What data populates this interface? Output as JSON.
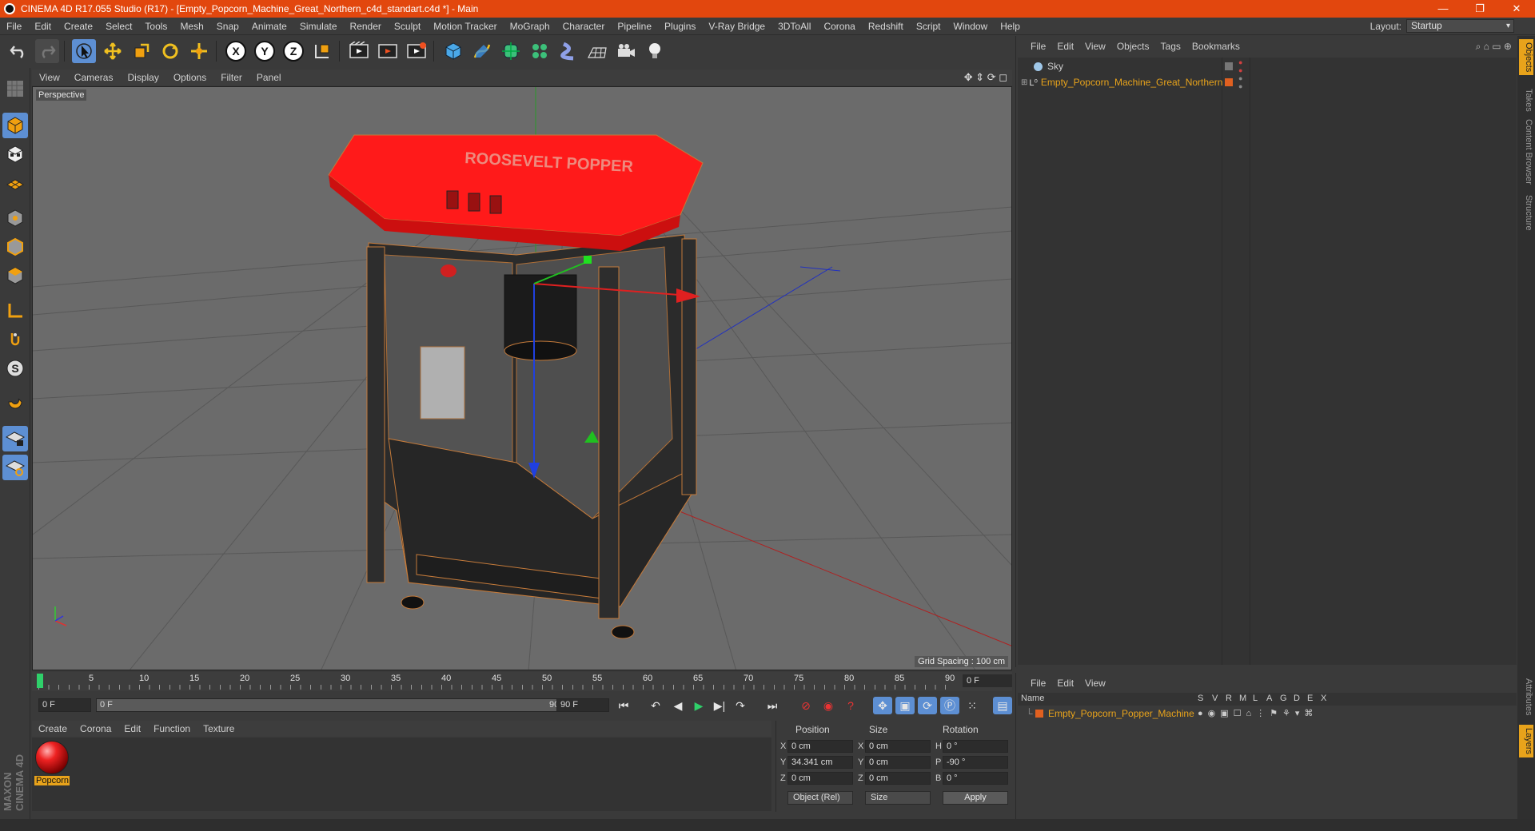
{
  "title_bar": {
    "title": "CINEMA 4D R17.055 Studio (R17) - [Empty_Popcorn_Machine_Great_Northern_c4d_standart.c4d *] - Main",
    "minimize": "—",
    "maximize": "❐",
    "close": "✕"
  },
  "menu": [
    "File",
    "Edit",
    "Create",
    "Select",
    "Tools",
    "Mesh",
    "Snap",
    "Animate",
    "Simulate",
    "Render",
    "Sculpt",
    "Motion Tracker",
    "MoGraph",
    "Character",
    "Pipeline",
    "Plugins",
    "V-Ray Bridge",
    "3DToAll",
    "Corona",
    "Redshift",
    "Script",
    "Window",
    "Help"
  ],
  "layout": {
    "label": "Layout:",
    "value": "Startup"
  },
  "toolbar": {
    "axis_x": "X",
    "axis_y": "Y",
    "axis_z": "Z"
  },
  "viewport": {
    "menu": [
      "View",
      "Cameras",
      "Display",
      "Options",
      "Filter",
      "Panel"
    ],
    "camera_label": "Perspective",
    "grid_spacing": "Grid Spacing : 100 cm",
    "sign_text": "ROOSEVELT POPPER"
  },
  "timeline": {
    "ticks": [
      "0",
      "5",
      "10",
      "15",
      "20",
      "25",
      "30",
      "35",
      "40",
      "45",
      "50",
      "55",
      "60",
      "65",
      "70",
      "75",
      "80",
      "85",
      "90"
    ],
    "current_frame": "0 F"
  },
  "playbar": {
    "start_frame": "0 F",
    "range_start": "0 F",
    "range_end": "90 F",
    "end_frame": "90 F"
  },
  "material_manager": {
    "menu": [
      "Create",
      "Corona",
      "Edit",
      "Function",
      "Texture"
    ],
    "materials": [
      {
        "name": "Popcorn",
        "color": "#e22222"
      }
    ]
  },
  "coordinates": {
    "headers": {
      "position": "Position",
      "size": "Size",
      "rotation": "Rotation"
    },
    "rows": [
      {
        "axis": "X",
        "pos": "0 cm",
        "size_axis": "X",
        "size": "0 cm",
        "rot_axis": "H",
        "rot": "0 °"
      },
      {
        "axis": "Y",
        "pos": "34.341 cm",
        "size_axis": "Y",
        "size": "0 cm",
        "rot_axis": "P",
        "rot": "-90 °"
      },
      {
        "axis": "Z",
        "pos": "0 cm",
        "size_axis": "Z",
        "size": "0 cm",
        "rot_axis": "B",
        "rot": "0 °"
      }
    ],
    "mode": "Object (Rel)",
    "size_mode": "Size",
    "apply": "Apply"
  },
  "object_manager": {
    "menu": [
      "File",
      "Edit",
      "View",
      "Objects",
      "Tags",
      "Bookmarks"
    ],
    "objects": [
      {
        "name": "Sky",
        "color": "#cfcfcf"
      },
      {
        "name": "Empty_Popcorn_Machine_Great_Northern",
        "color": "#e8a31b"
      }
    ]
  },
  "layer_manager": {
    "menu": [
      "File",
      "Edit",
      "View"
    ],
    "headers": [
      "Name",
      "S",
      "V",
      "R",
      "M",
      "L",
      "A",
      "G",
      "D",
      "E",
      "X"
    ],
    "layers": [
      {
        "name": "Empty_Popcorn_Popper_Machine",
        "color": "#e8a31b"
      }
    ]
  },
  "side_tabs": [
    "Objects",
    "Takes",
    "Content Browser",
    "Structure"
  ],
  "side_tabs_bottom": [
    "Attributes",
    "Layers"
  ],
  "brand": "MAXON CINEMA 4D",
  "colors": {
    "accent": "#5d8fd3",
    "titlebar": "#e2470e",
    "highlight": "#e8a31b"
  }
}
